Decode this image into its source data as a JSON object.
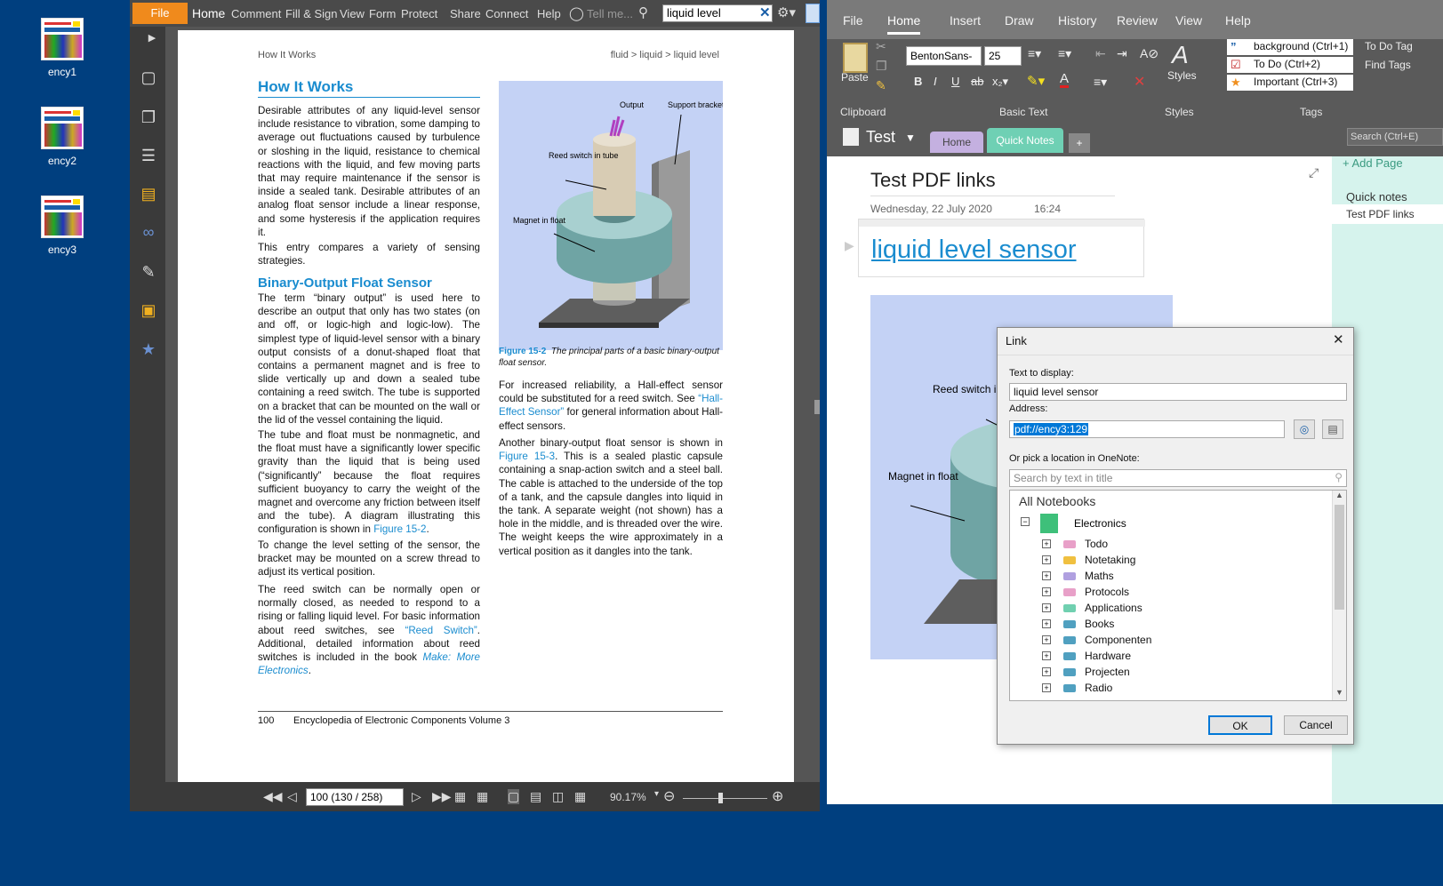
{
  "desktop": {
    "icons": [
      {
        "label": "ency1"
      },
      {
        "label": "ency2"
      },
      {
        "label": "ency3"
      }
    ]
  },
  "pdf_viewer": {
    "menu": {
      "file": "File",
      "items": [
        "Home",
        "Comment",
        "Fill & Sign",
        "View",
        "Form",
        "Protect",
        "Share",
        "Connect",
        "Help"
      ],
      "tell_me": "Tell me...",
      "search_value": "liquid level"
    },
    "page": {
      "header_left": "How It Works",
      "header_right": "fluid > liquid > liquid level",
      "heading1": "How It Works",
      "p1": "Desirable attributes of any liquid-level sensor include resistance to vibration, some damping to average out fluctuations caused by turbulence or sloshing in the liquid, resistance to chemical reactions with the liquid, and few moving parts that may require maintenance if the sensor is inside a sealed tank. Desirable attributes of an analog float sensor include a linear response, and some hysteresis if the application requires it.",
      "p2": "This entry compares a variety of sensing strategies.",
      "heading2": "Binary-Output Float Sensor",
      "p3": "The term “binary output” is used here to describe an output that only has two states (on and off, or logic-high and logic-low). The simplest type of liquid-level sensor with a binary output consists of a donut-shaped float that contains a permanent magnet and is free to slide vertically up and down a sealed tube containing a reed switch. The tube is supported on a bracket that can be mounted on the wall or the lid of the vessel containing the liquid.",
      "p4_a": "The tube and float must be nonmagnetic, and the float must have a significantly lower specific gravity than the liquid that is being used (“significantly” because the float requires sufficient buoyancy to carry the weight of the magnet and overcome any friction between itself and the tube). A diagram illustrating this configuration is shown in ",
      "p4_link": "Figure 15-2",
      "p5": "To change the level setting of the sensor, the bracket may be mounted on a screw thread to adjust its vertical position.",
      "p6_a": "The reed switch can be normally open or normally closed, as needed to respond to a rising or falling liquid level. For basic information about reed switches, see ",
      "p6_link1": "“Reed Switch”",
      "p6_b": ". Additional, detailed information about reed switches is included in the book ",
      "p6_link2": "Make: More Electronics",
      "fig_labels": {
        "output": "Output",
        "support": "Support bracket",
        "reed": "Reed switch in tube",
        "magnet": "Magnet in float"
      },
      "caption_num": "Figure 15-2",
      "caption_text": "The principal parts of a basic binary-output float sensor.",
      "p7_a": "For increased reliability, a Hall-effect sensor could be substituted for a reed switch. See ",
      "p7_link": "“Hall-Effect Sensor”",
      "p7_b": " for general information about Hall-effect sensors.",
      "p8_a": "Another binary-output float sensor is shown in ",
      "p8_link": "Figure 15-3",
      "p8_b": ". This is a sealed plastic capsule containing a snap-action switch and a steel ball. The cable is attached to the underside of the top of a tank, and the capsule dangles into liquid in the tank. A separate weight (not shown) has a hole in the middle, and is threaded over the wire. The weight keeps the wire approximately in a vertical position as it dangles into the tank.",
      "footer_num": "100",
      "footer_title": "Encyclopedia of Electronic Components Volume 3"
    },
    "bottom": {
      "page_field": "100 (130 / 258)",
      "zoom": "90.17%"
    }
  },
  "onenote": {
    "tabs": [
      "File",
      "Home",
      "Insert",
      "Draw",
      "History",
      "Review",
      "View",
      "Help"
    ],
    "active_tab": "Home",
    "ribbon": {
      "paste": "Paste",
      "font": "BentonSans-",
      "size": "25",
      "styles": "Styles",
      "group_clipboard": "Clipboard",
      "group_basic_text": "Basic Text",
      "group_styles": "Styles",
      "group_tags": "Tags",
      "tags": [
        "background (Ctrl+1)",
        "To Do (Ctrl+2)",
        "Important (Ctrl+3)"
      ],
      "todo_tag": "To Do Tag",
      "find_tags": "Find Tags"
    },
    "notebook": {
      "name": "Test",
      "sections": [
        "Home",
        "Quick Notes",
        "+"
      ],
      "search": "Search (Ctrl+E)"
    },
    "page": {
      "title": "Test PDF links",
      "date": "Wednesday, 22 July 2020",
      "time": "16:24",
      "link_text": "liquid level sensor"
    },
    "pagelist": {
      "add_page": "Add Page",
      "section": "Quick notes",
      "page": "Test PDF links"
    },
    "image_labels": {
      "reed": "Reed switch in tube",
      "magnet": "Magnet in float"
    }
  },
  "link_dialog": {
    "title": "Link",
    "text_label": "Text to display:",
    "text_value": "liquid level sensor",
    "address_label": "Address:",
    "address_value": "pdf://ency3:129",
    "pick_label": "Or pick a location in OneNote:",
    "search_placeholder": "Search by text in title",
    "tree_root": "All Notebooks",
    "notebook": "Electronics",
    "sections": [
      {
        "name": "Todo",
        "color": "#e8a0c8"
      },
      {
        "name": "Notetaking",
        "color": "#f0c040"
      },
      {
        "name": "Maths",
        "color": "#b0a0e0"
      },
      {
        "name": "Protocols",
        "color": "#e8a0c8"
      },
      {
        "name": "Applications",
        "color": "#70d0b0"
      },
      {
        "name": "Books",
        "color": "#50a0c0"
      },
      {
        "name": "Componenten",
        "color": "#50a0c0"
      },
      {
        "name": "Hardware",
        "color": "#50a0c0"
      },
      {
        "name": "Projecten",
        "color": "#50a0c0"
      },
      {
        "name": "Radio",
        "color": "#50a0c0"
      }
    ],
    "ok": "OK",
    "cancel": "Cancel"
  }
}
